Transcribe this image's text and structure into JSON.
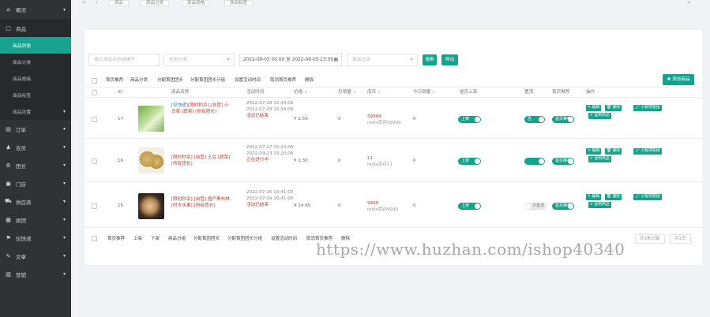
{
  "sidebar": {
    "items": [
      {
        "label": "概况",
        "icon": "home-icon",
        "arrow": true
      },
      {
        "label": "商品",
        "icon": "box-icon",
        "arrow": false,
        "active": true
      },
      {
        "label": "订单",
        "icon": "order-icon",
        "arrow": true
      },
      {
        "label": "会员",
        "icon": "user-icon",
        "arrow": true
      },
      {
        "label": "团长",
        "icon": "leader-icon",
        "arrow": true
      },
      {
        "label": "门店",
        "icon": "store-icon",
        "arrow": true
      },
      {
        "label": "供应商",
        "icon": "supplier-icon",
        "arrow": true
      },
      {
        "label": "拼团",
        "icon": "group-icon",
        "arrow": true
      },
      {
        "label": "仅快递",
        "icon": "delivery-icon",
        "arrow": true
      },
      {
        "label": "文章",
        "icon": "article-icon",
        "arrow": true
      },
      {
        "label": "营销",
        "icon": "marketing-icon",
        "arrow": true
      }
    ],
    "subitems": [
      "商品列表",
      "商品分类",
      "商品规格",
      "商品标签",
      "商品设置"
    ]
  },
  "topbar": {
    "tabs": [
      "商品",
      "商品分类",
      "商品规格",
      "商品标签"
    ]
  },
  "filters": {
    "keyword_placeholder": "输入商品名称或编号",
    "category_placeholder": "全部分类",
    "date_range": "2022-08-05 00:00 至 2022-08-05 23:59",
    "type_placeholder": "商品分类",
    "search_label": "搜索",
    "export_label": "导出"
  },
  "toolbar": {
    "buttons": [
      "首页推荐",
      "商品分类",
      "分配首团团长",
      "分配首团团长分组",
      "设置活动时间",
      "取消首页推荐",
      "删除"
    ],
    "add_label": "添加商品"
  },
  "table": {
    "headers": {
      "id": "ID",
      "name": "商品名称",
      "activity_time": "活动时间",
      "price": "价格",
      "total_sales": "总销量",
      "stock": "库存",
      "today_sales": "今日销量",
      "on_shelf": "是否上架",
      "limit": "置顶",
      "home_recommend": "首页推荐",
      "ops": "操作"
    },
    "rows": [
      {
        "id": "17",
        "name_blue": "[仅快递]",
        "name_rest": "[限时秒杀] [自营] 小白菜 [蔬菜] [所有团长]",
        "time1": "2022-07-28 15:34:00",
        "time2": "2022-07-29 15:34:00",
        "status": "活动已结束",
        "price": "¥ 2.59",
        "total": "0",
        "stock_num": "59999",
        "stock_redis": "redis库存59999",
        "today": "0",
        "shelf": "上架",
        "top": "否",
        "home": "首页推荐",
        "ops": [
          "编辑",
          "删除",
          "小程序链接",
          "复制商品"
        ]
      },
      {
        "id": "16",
        "name_blue": "",
        "name_rest": "[限时秒杀] [自营] 土豆 [蔬菜] [所有团长]",
        "time1": "2022-07-27 15:20:00",
        "time2": "2022-09-23 15:20:00",
        "status": "正在进行中",
        "price": "¥ 1.30",
        "total": "0",
        "stock_num": "11",
        "stock_redis": "redis库存11",
        "today": "0",
        "shelf": "上架",
        "top": "",
        "home": "首页推荐",
        "ops": [
          "编辑",
          "删除",
          "小程序链接",
          "复制商品"
        ]
      },
      {
        "id": "15",
        "name_blue": "",
        "name_rest": "[限时秒杀] [自营] 国产黑布林 [时令水果] [所有团长]",
        "time1": "2022-07-26 16:41:00",
        "time2": "2022-07-29 16:41:00",
        "status": "活动已结束",
        "price": "¥ 14.95",
        "total": "0",
        "stock_num": "9999",
        "stock_redis": "redis库存9999",
        "today": "0",
        "shelf": "上架",
        "top": "不置顶",
        "home": "首页推荐",
        "ops": [
          "编辑",
          "删除",
          "小程序链接",
          "复制商品"
        ]
      }
    ]
  },
  "footer": {
    "buttons": [
      "首页推荐",
      "上架",
      "下架",
      "商品分组",
      "分配首团团长",
      "分配首团团长分组",
      "设置活动时间",
      "取消首页推荐",
      "删除"
    ],
    "total": "共3条记录",
    "pages": "共1页"
  },
  "watermark": "https://www.huzhan.com/ishop40340",
  "colors": {
    "accent": "#15a38b",
    "sidebar": "#2f3336",
    "danger": "#c0392b"
  }
}
